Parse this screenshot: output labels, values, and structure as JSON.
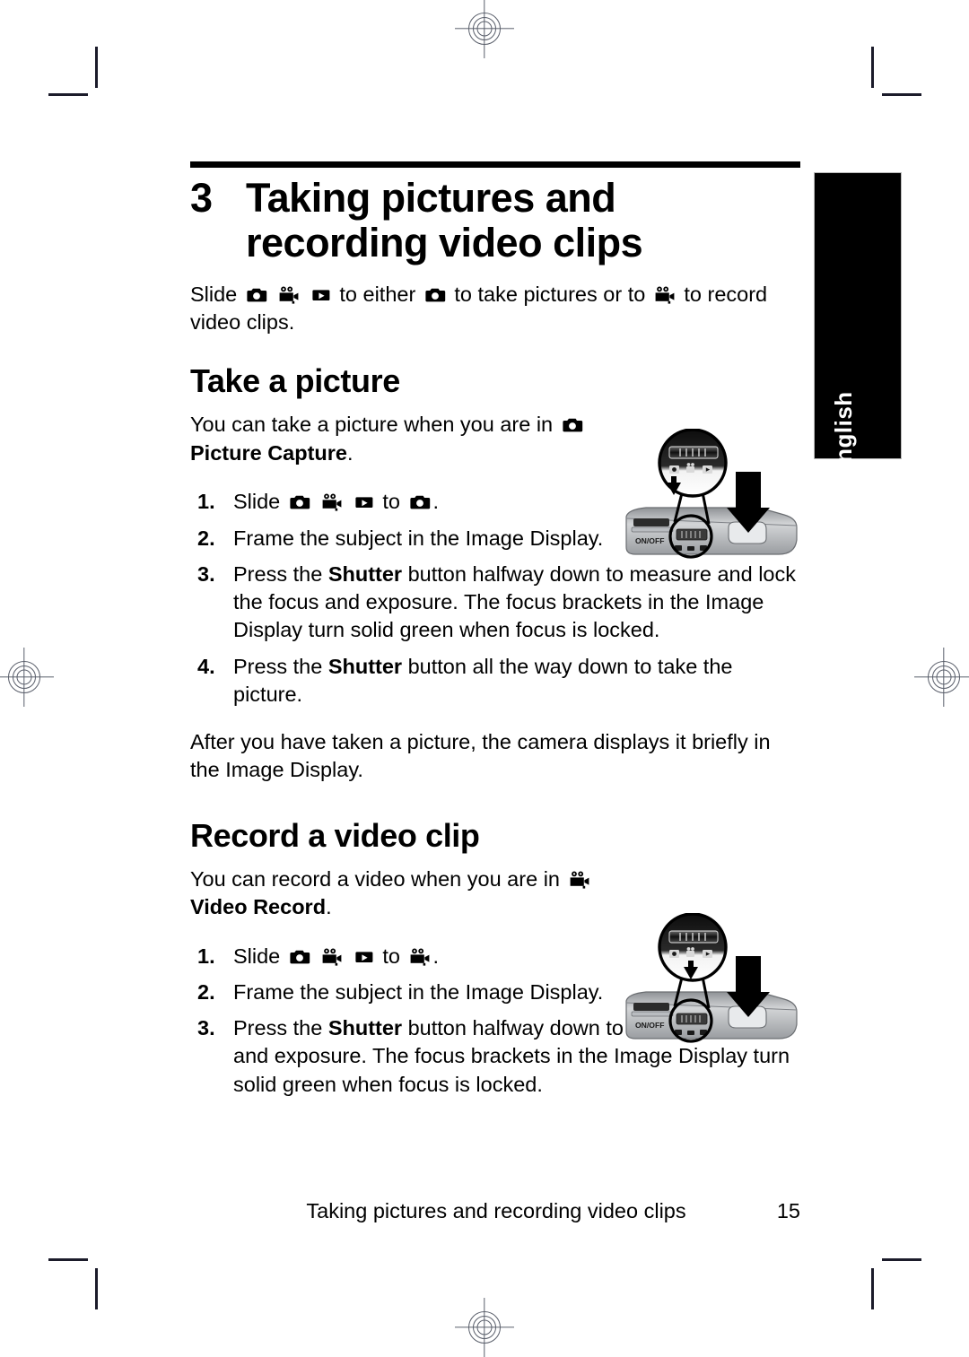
{
  "document": {
    "language_tab": "English",
    "chapter_number": "3",
    "chapter_title": "Taking pictures and recording video clips",
    "intro": {
      "part1": "Slide",
      "part2": "to either",
      "part3": "to take pictures or to",
      "part4": "to record video clips."
    }
  },
  "sections": [
    {
      "heading": "Take a picture",
      "intro_line1": "You can take a picture when you are in",
      "intro_mode": "Picture Capture",
      "intro_period": ".",
      "steps": [
        {
          "num": "1.",
          "prefix": "Slide",
          "middle": "to",
          "suffix": "."
        },
        {
          "num": "2.",
          "text": "Frame the subject in the Image Display."
        },
        {
          "num": "3.",
          "pre": "Press the",
          "bold": "Shutter",
          "post": "button halfway down to measure and lock the focus and exposure. The focus brackets in the Image Display turn solid green when focus is locked."
        },
        {
          "num": "4.",
          "pre": "Press the",
          "bold": "Shutter",
          "post": "button all the way down to take the picture."
        }
      ],
      "closing": "After you have taken a picture, the camera displays it briefly in the Image Display."
    },
    {
      "heading": "Record a video clip",
      "intro_line1": "You can record a video when you are",
      "intro_prefix": "in",
      "intro_mode": "Video Record",
      "intro_period": ".",
      "steps": [
        {
          "num": "1.",
          "prefix": "Slide",
          "middle": "to",
          "suffix": "."
        },
        {
          "num": "2.",
          "text": "Frame the subject in the Image Display."
        },
        {
          "num": "3.",
          "pre": "Press the",
          "bold": "Shutter",
          "post": "button halfway down to measure focus and exposure. The focus brackets in the Image Display turn solid green when focus is locked."
        }
      ]
    }
  ],
  "figures": {
    "picture_capture": {
      "onoff_label": "ON/OFF",
      "highlighted_mode": "picture-capture"
    },
    "video_record": {
      "onoff_label": "ON/OFF",
      "highlighted_mode": "video-record"
    }
  },
  "icons": {
    "still_camera": "still-camera-icon",
    "video_camera": "video-camera-icon",
    "playback": "playback-icon"
  },
  "footer": {
    "title": "Taking pictures and recording video clips",
    "page_number": "15"
  },
  "colors": {
    "ink": "#000000",
    "paper": "#ffffff",
    "registration": "#5a5f6b",
    "camera_body": "#b9bcc0"
  }
}
